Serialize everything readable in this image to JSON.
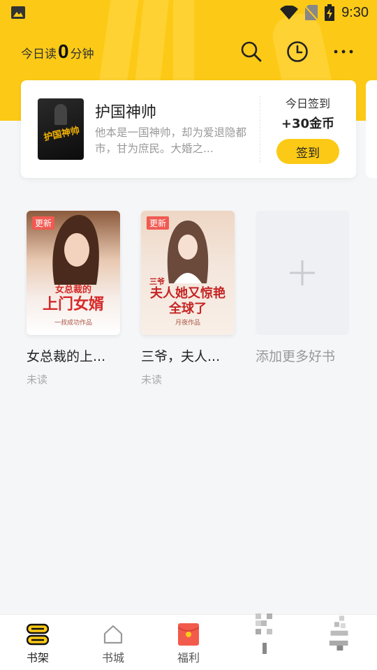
{
  "status_bar": {
    "time": "9:30"
  },
  "header": {
    "reading_prefix": "今日读",
    "reading_minutes": "0",
    "reading_suffix": "分钟"
  },
  "featured": {
    "title": "护国神帅",
    "description": "他本是一国神帅，却为爱退隐都市，甘为庶民。大婚之...",
    "cover_text": "护国神帅",
    "sign_label": "今日签到",
    "reward": "+30金币",
    "sign_button": "签到"
  },
  "shelf": {
    "books": [
      {
        "name": "女总裁的上...",
        "status": "未读",
        "badge": "更新",
        "cover_title": "上门女婿",
        "cover_subtitle": "女总裁的",
        "cover_author": "一叔成功作品"
      },
      {
        "name": "三爷，夫人...",
        "status": "未读",
        "badge": "更新",
        "cover_title": "夫人她又惊艳全球了",
        "cover_subtitle": "三爷",
        "cover_author": "月夜作品"
      }
    ],
    "add_label": "添加更多好书"
  },
  "bottom_nav": {
    "items": [
      {
        "label": "书架",
        "icon": "bookshelf-icon",
        "active": true
      },
      {
        "label": "书城",
        "icon": "home-icon"
      },
      {
        "label": "福利",
        "icon": "gift-envelope-icon"
      },
      {
        "label": "",
        "icon": "blurred-icon"
      },
      {
        "label": "",
        "icon": "blurred-icon"
      }
    ]
  },
  "colors": {
    "accent": "#fcca16",
    "badge": "#f05a52",
    "background": "#f5f6f8"
  }
}
